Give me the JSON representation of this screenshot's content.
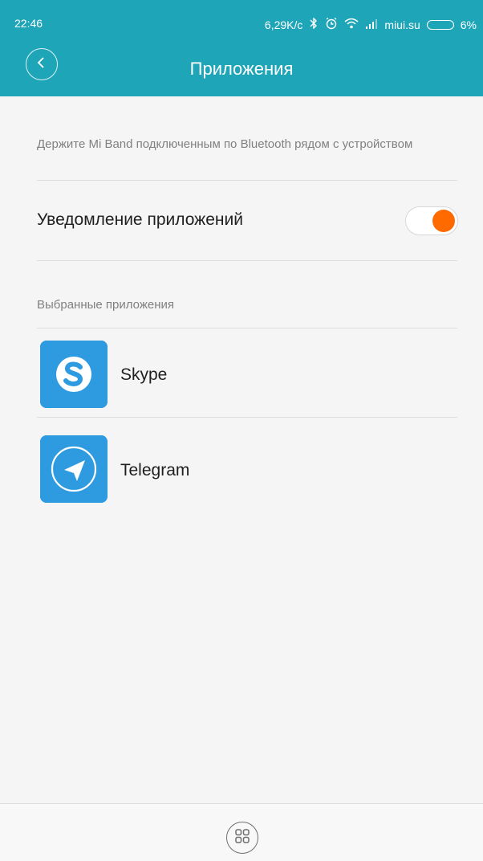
{
  "status_bar": {
    "time": "22:46",
    "net_speed": "6,29K/c",
    "carrier": "miui.su",
    "battery": "6%",
    "icons": [
      "bluetooth-icon",
      "alarm-icon",
      "wifi-icon",
      "signal-icon",
      "battery-icon"
    ]
  },
  "header": {
    "title": "Приложения",
    "back_icon": "chevron-left-icon",
    "color": "#1fa5b8"
  },
  "hint": {
    "text": "Держите Mi Band подключенным по Bluetooth рядом с устройством"
  },
  "notifications": {
    "label": "Уведомление приложений",
    "enabled": true,
    "accent": "#ff6a00"
  },
  "selected_apps": {
    "title": "Выбранные приложения",
    "items": [
      {
        "name": "Skype",
        "icon": "skype-icon"
      },
      {
        "name": "Telegram",
        "icon": "telegram-icon"
      }
    ]
  },
  "footer": {
    "icon": "grid-icon"
  }
}
